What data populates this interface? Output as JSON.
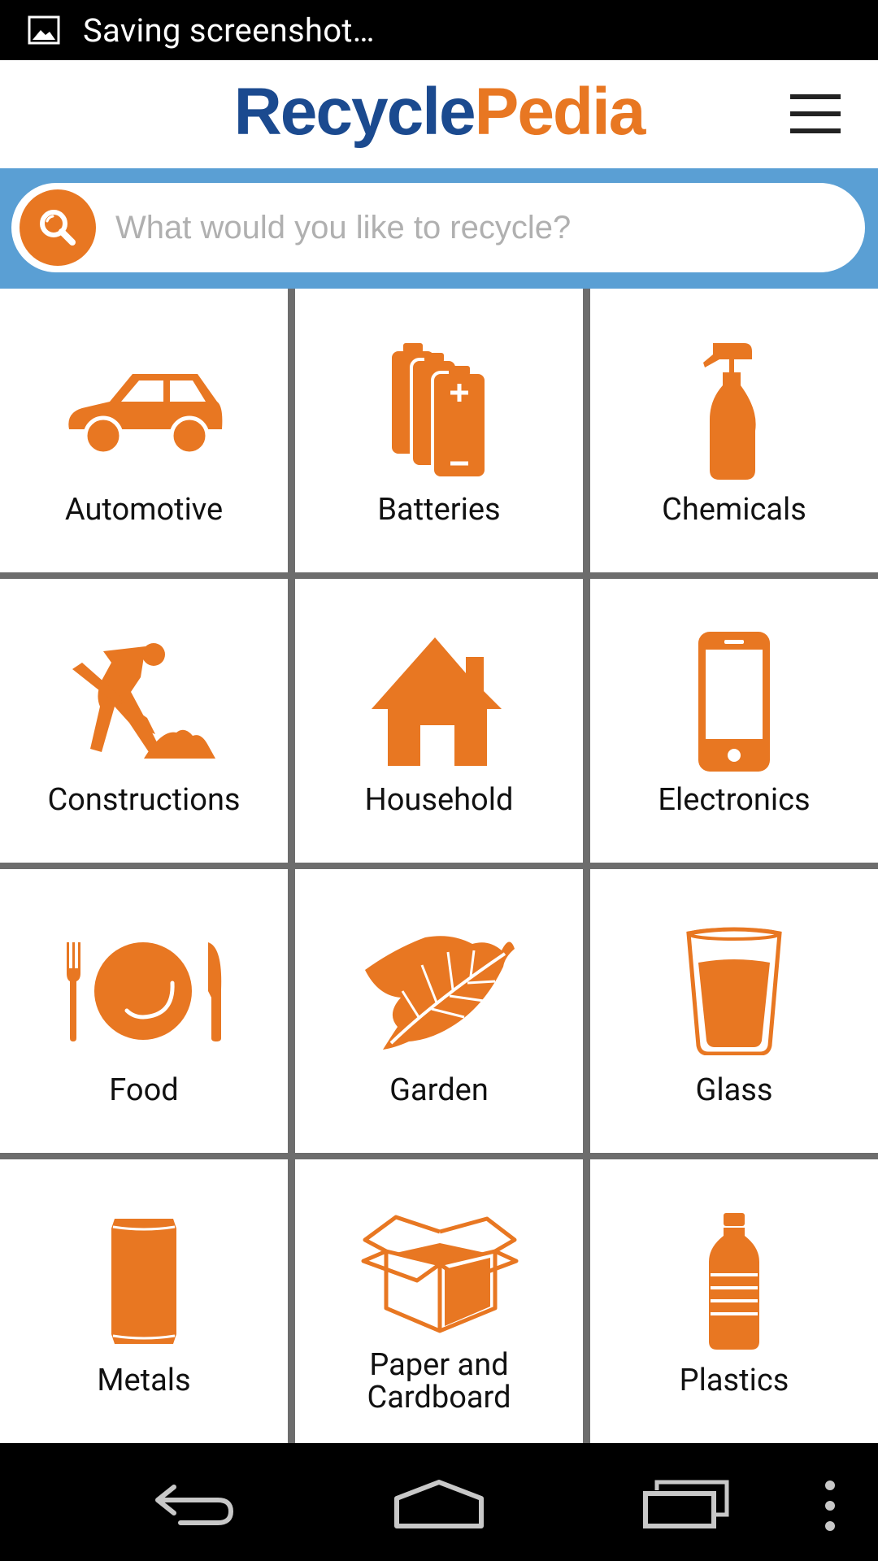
{
  "status_bar": {
    "icon": "image-icon",
    "text": "Saving screenshot…"
  },
  "header": {
    "logo_part1": "Recycle",
    "logo_part2": "Pedia",
    "menu_icon": "hamburger-menu-icon"
  },
  "search": {
    "placeholder": "What would you like to recycle?",
    "icon": "search-icon"
  },
  "categories": [
    {
      "label": "Automotive",
      "icon": "car-icon"
    },
    {
      "label": "Batteries",
      "icon": "batteries-icon"
    },
    {
      "label": "Chemicals",
      "icon": "spray-bottle-icon"
    },
    {
      "label": "Constructions",
      "icon": "construction-worker-icon"
    },
    {
      "label": "Household",
      "icon": "house-icon"
    },
    {
      "label": "Electronics",
      "icon": "smartphone-icon"
    },
    {
      "label": "Food",
      "icon": "plate-utensils-icon"
    },
    {
      "label": "Garden",
      "icon": "leaf-icon"
    },
    {
      "label": "Glass",
      "icon": "drinking-glass-icon"
    },
    {
      "label": "Metals",
      "icon": "can-icon"
    },
    {
      "label": "Paper and Cardboard",
      "icon": "cardboard-box-icon"
    },
    {
      "label": "Plastics",
      "icon": "plastic-bottle-icon"
    }
  ],
  "nav_bar": {
    "back": "back-icon",
    "home": "home-icon",
    "recents": "recents-icon",
    "overflow": "overflow-menu-icon"
  },
  "colors": {
    "orange": "#E87722",
    "blue": "#1B4A8F",
    "band": "#5A9FD4"
  }
}
